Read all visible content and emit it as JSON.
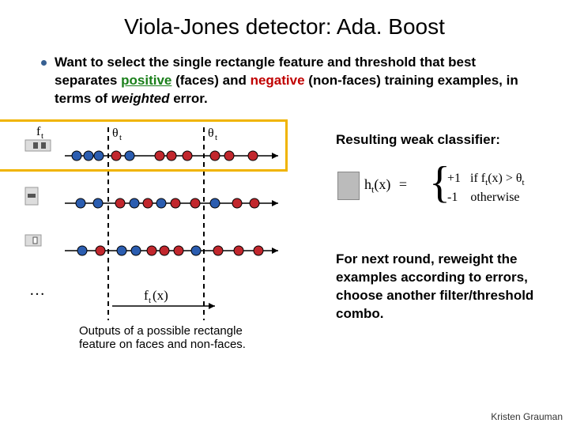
{
  "title": "Viola-Jones detector: Ada. Boost",
  "bullet": {
    "pre": "Want to select the single rectangle feature and threshold that best separates ",
    "positive": "positive",
    "mid1": " (faces) and ",
    "negative": "negative",
    "mid2": " (non-faces) training examples, in terms of ",
    "weighted": "weighted",
    "post": " error."
  },
  "diagram": {
    "feature_label": "f",
    "feature_sub": "t",
    "threshold_label": "θ",
    "threshold_sub": "t",
    "axis_label": "f",
    "axis_sub": "t",
    "axis_arg": "(x)",
    "dots": "…"
  },
  "right": {
    "resulting": "Resulting weak classifier:",
    "eq_lhs": "h",
    "eq_lhs_sub": "t",
    "eq_lhs_arg": "(x)",
    "eq_eq": "=",
    "case1_val": "+1",
    "case1_if": "if  f",
    "case1_sub": "t",
    "case1_rest": "(x) > θ",
    "case1_sub2": "t",
    "case2_val": "-1",
    "case2_rest": "otherwise",
    "next": "For next round, reweight the examples according to errors, choose another filter/threshold combo."
  },
  "caption": "Outputs of a possible rectangle feature on faces and non-faces.",
  "credit": "Kristen Grauman"
}
